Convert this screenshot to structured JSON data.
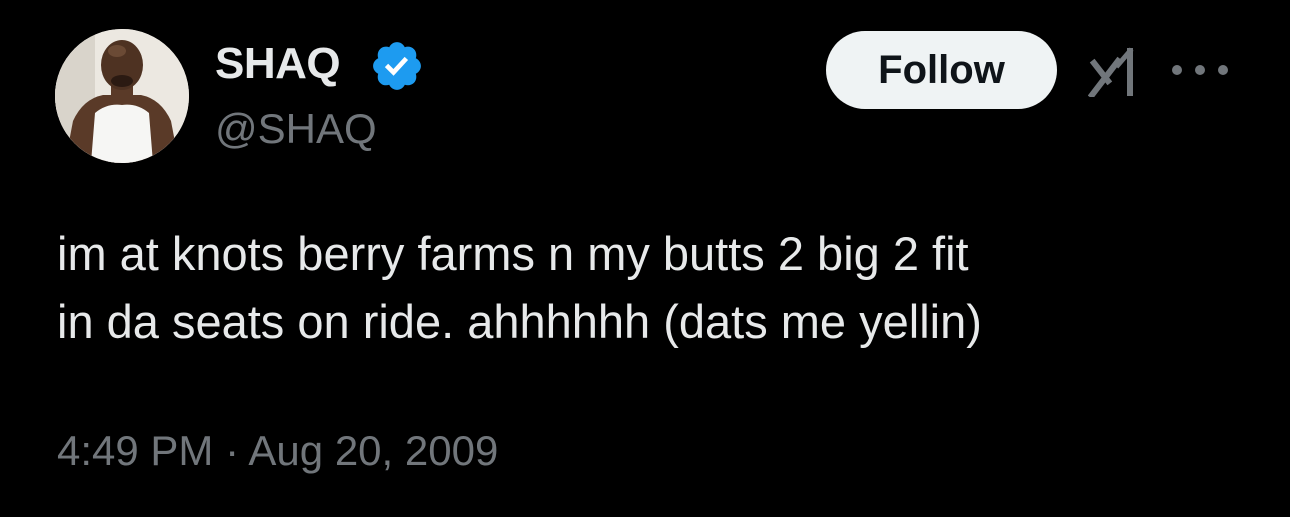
{
  "author": {
    "display_name": "SHAQ",
    "handle": "@SHAQ",
    "verified": true,
    "avatar_icon": "profile-photo"
  },
  "header_actions": {
    "follow_label": "Follow",
    "grok_icon": "grok-icon",
    "more_icon": "more-icon"
  },
  "tweet": {
    "text_line_1": "im at knots berry farms n my butts 2 big 2 fit",
    "text_line_2": "in da seats on ride. ahhhhhh (dats me yellin)",
    "timestamp": "4:49 PM · Aug 20, 2009"
  },
  "colors": {
    "background": "#000000",
    "primary_text": "#e7e9ea",
    "secondary_text": "#71767b",
    "verified_badge": "#1d9bf0",
    "follow_button_bg": "#eff3f4",
    "follow_button_text": "#0f1419"
  }
}
